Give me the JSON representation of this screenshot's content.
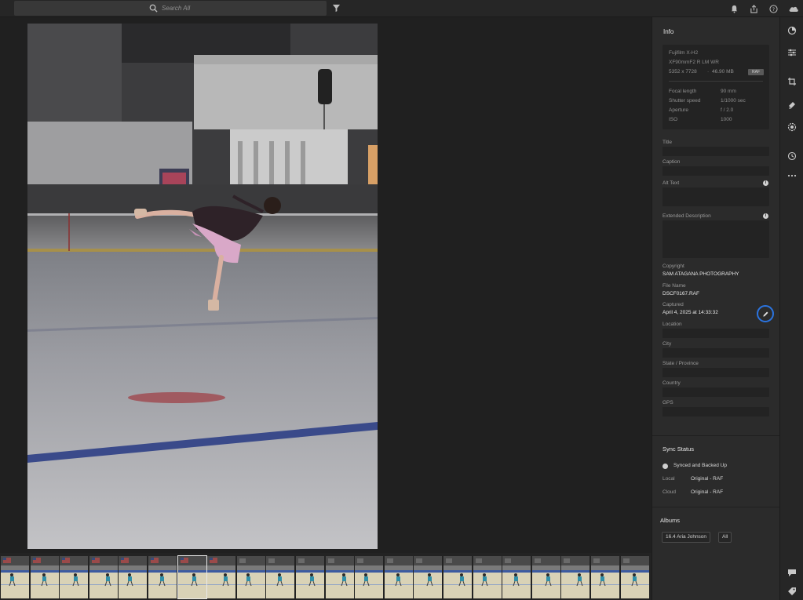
{
  "search": {
    "placeholder": "Search All"
  },
  "topbar": {
    "icons": [
      "filter-icon",
      "bell-icon",
      "share-icon",
      "help-icon",
      "cloud-icon"
    ]
  },
  "info": {
    "title": "Info",
    "camera": {
      "model": "Fujifilm X-H2",
      "lens": "XF90mmF2 R LM WR",
      "dimensions": "5352 x 7728",
      "filesize": "46.90 MB",
      "format": "RAF",
      "focal_label": "Focal length",
      "focal_value": "90 mm",
      "shutter_label": "Shutter speed",
      "shutter_value": "1/1000 sec",
      "aperture_label": "Aperture",
      "aperture_value": "f / 2.0",
      "iso_label": "ISO",
      "iso_value": "1000"
    },
    "title_label": "Title",
    "title_value": "",
    "caption_label": "Caption",
    "caption_value": "",
    "alt_label": "Alt Text",
    "alt_value": "",
    "extended_label": "Extended Description",
    "extended_value": "",
    "copyright_label": "Copyright",
    "copyright_value": "SAM ATAGANA PHOTOGRAPHY",
    "filename_label": "File Name",
    "filename_value": "DSCF0167.RAF",
    "captured_label": "Captured",
    "captured_value": "April 4, 2025 at 14:33:32",
    "location_label": "Location",
    "location_value": "",
    "city_label": "City",
    "city_value": "",
    "state_label": "State / Province",
    "state_value": "",
    "country_label": "Country",
    "country_value": "",
    "gps_label": "GPS",
    "gps_value": ""
  },
  "sync": {
    "title": "Sync Status",
    "status": "Synced and Backed Up",
    "local_label": "Local",
    "local_value": "Original - RAF",
    "cloud_label": "Cloud",
    "cloud_value": "Original - RAF"
  },
  "albums": {
    "title": "Albums",
    "items": [
      "16.4 Aria Johnson",
      "All"
    ]
  },
  "filmstrip": {
    "count": 22,
    "selected_index": 6
  },
  "toolbar": {
    "icons": [
      "presets-icon",
      "edit-sliders-icon",
      "crop-icon",
      "healing-icon",
      "masking-icon",
      "versions-icon",
      "more-icon",
      "comments-icon",
      "keywords-icon"
    ]
  },
  "colors": {
    "accent": "#2b74e0",
    "panel": "#2b2b2b",
    "background": "#1f1f1f"
  }
}
